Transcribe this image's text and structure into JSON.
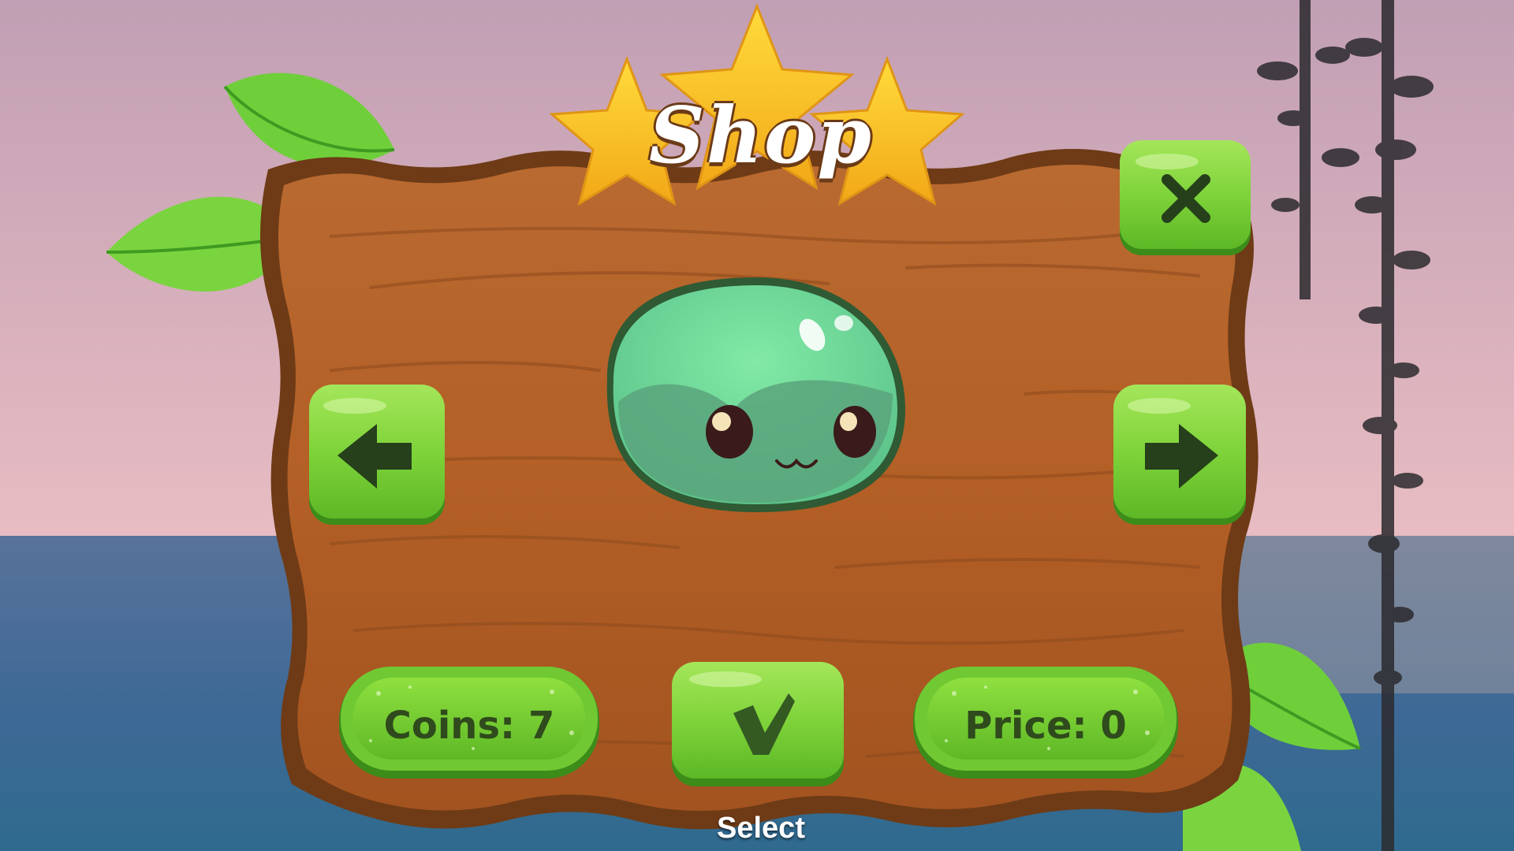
{
  "shop": {
    "title": "Shop",
    "coins_label": "Coins: 7",
    "price_label": "Price: 0",
    "select_label": "Select"
  },
  "icons": {
    "close": "close-icon",
    "previous": "arrow-left-icon",
    "next": "arrow-right-icon",
    "confirm": "checkmark-icon",
    "character": "green-slime-character"
  },
  "colors": {
    "sky_top": "#c7a2b5",
    "sky_bottom": "#e5b8c0",
    "sea": "#3f6b96",
    "wood": "#b8642b",
    "wood_dark": "#6e3b16",
    "button_green": "#7fd33a",
    "button_dark": "#4a9a1e",
    "star": "#f6c12a",
    "slime": "#6fd59a",
    "slime_dark": "#2d5a36"
  }
}
